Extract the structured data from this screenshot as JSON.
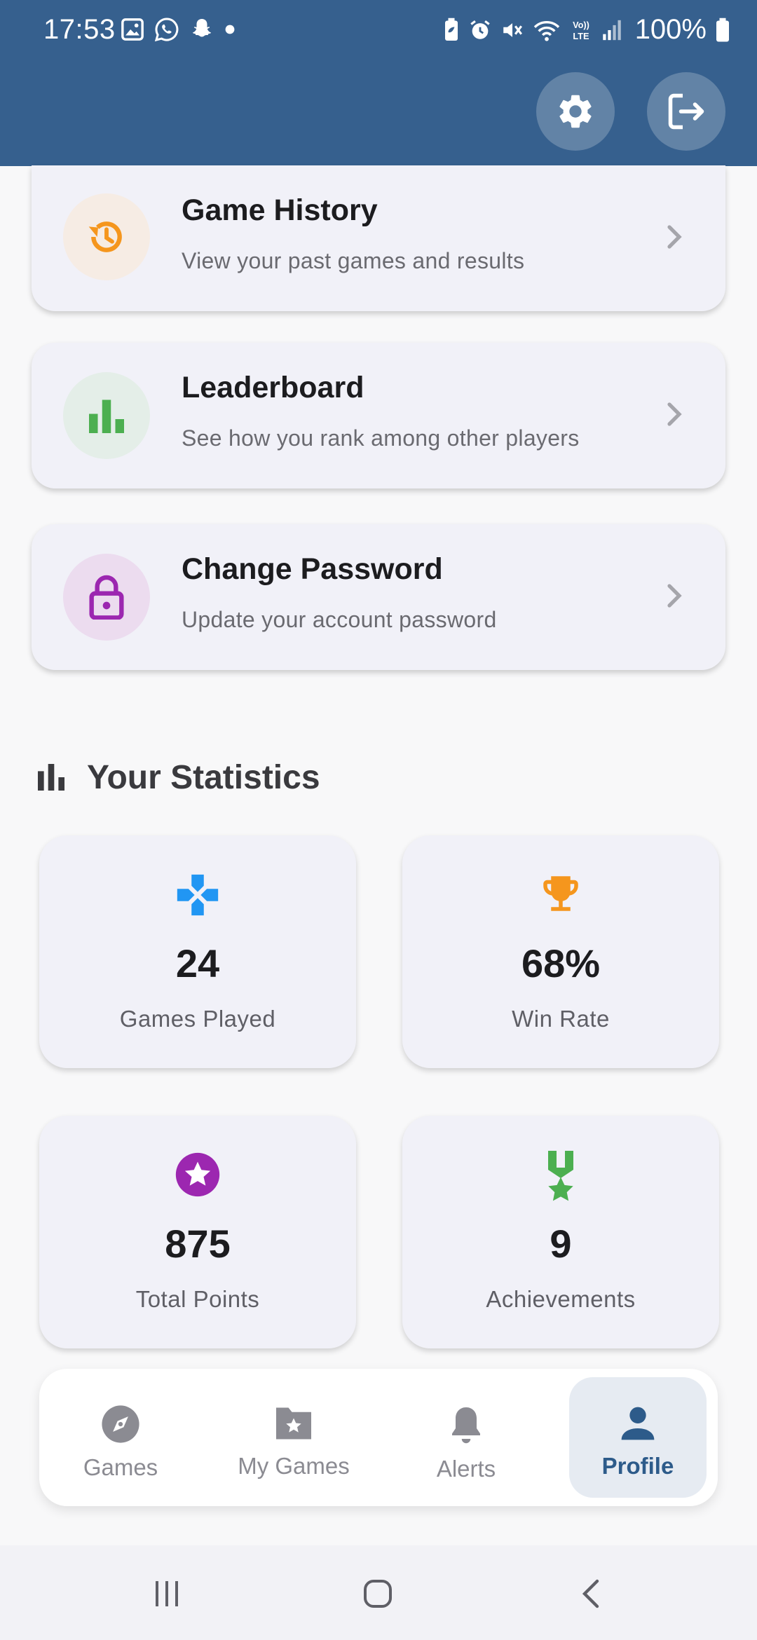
{
  "status_bar": {
    "time": "17:53",
    "battery": "100%",
    "left_icons": [
      "gallery-icon",
      "whatsapp-icon",
      "snapchat-icon",
      "dot-icon"
    ],
    "right_icons": [
      "battery-saver-icon",
      "alarm-icon",
      "mute-icon",
      "wifi-icon",
      "volte-icon",
      "signal-icon",
      "battery-icon"
    ]
  },
  "header": {
    "settings_icon": "gear-icon",
    "logout_icon": "logout-icon",
    "background_color": "#36608e"
  },
  "menu": [
    {
      "title": "Game History",
      "subtitle": "View your past games and results",
      "icon": "history-icon",
      "icon_color": "#f5961d",
      "circle_color": "#f6ece4"
    },
    {
      "title": "Leaderboard",
      "subtitle": "See how you rank among other players",
      "icon": "bar-chart-icon",
      "icon_color": "#4caf50",
      "circle_color": "#e4eee8"
    },
    {
      "title": "Change Password",
      "subtitle": "Update your account password",
      "icon": "lock-icon",
      "icon_color": "#9c27b0",
      "circle_color": "#ecdcef"
    }
  ],
  "statistics": {
    "heading": "Your Statistics",
    "heading_icon": "bar-chart-icon",
    "cards": [
      {
        "value": "24",
        "label": "Games Played",
        "icon": "gamepad-icon",
        "icon_color": "#2196f3"
      },
      {
        "value": "68%",
        "label": "Win Rate",
        "icon": "trophy-icon",
        "icon_color": "#f5961d"
      },
      {
        "value": "875",
        "label": "Total Points",
        "icon": "star-badge-icon",
        "icon_color": "#9c27b0"
      },
      {
        "value": "9",
        "label": "Achievements",
        "icon": "medal-icon",
        "icon_color": "#4caf50"
      }
    ]
  },
  "bottom_nav": {
    "items": [
      {
        "label": "Games",
        "icon": "compass-icon",
        "active": false
      },
      {
        "label": "My Games",
        "icon": "folder-star-icon",
        "active": false
      },
      {
        "label": "Alerts",
        "icon": "bell-icon",
        "active": false
      },
      {
        "label": "Profile",
        "icon": "person-icon",
        "active": true
      }
    ],
    "active_color": "#2d5b8a"
  },
  "system_nav": {
    "buttons": [
      "recents-icon",
      "home-icon",
      "back-icon"
    ]
  }
}
